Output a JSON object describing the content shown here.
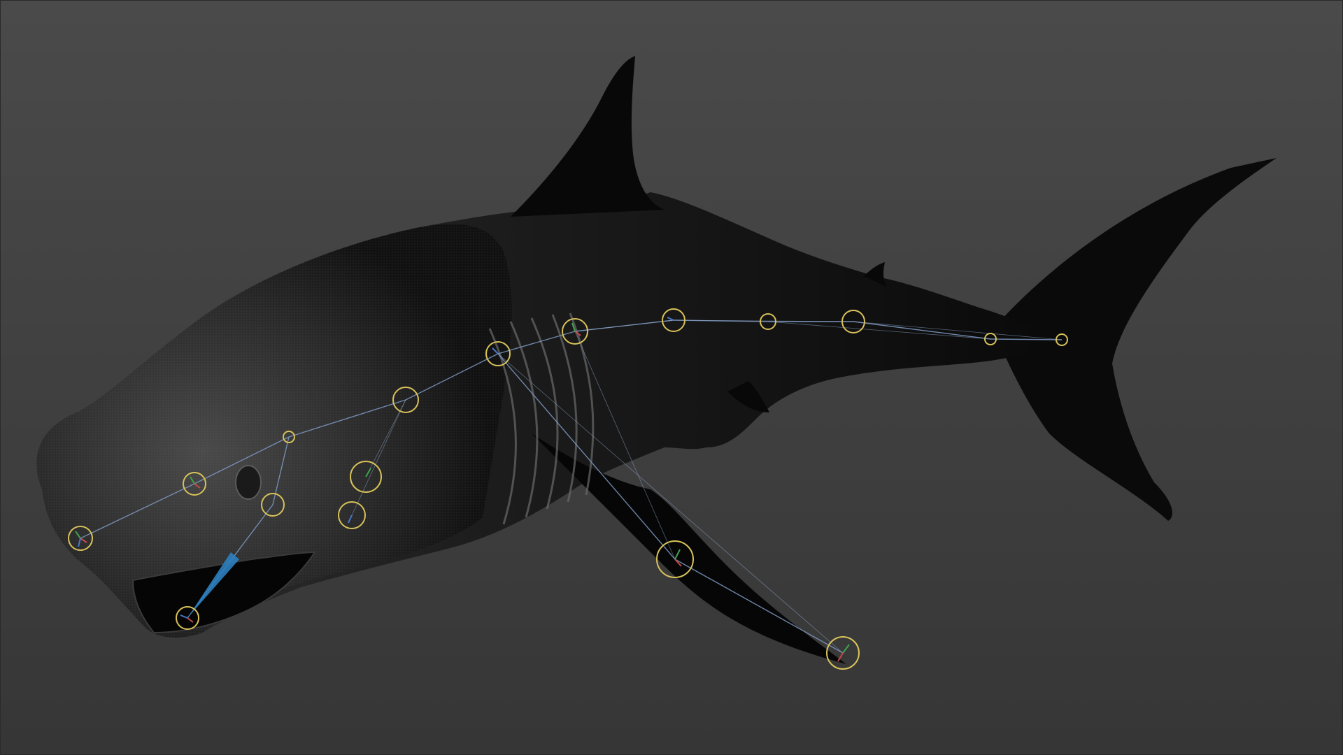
{
  "viewport": {
    "background_top": "#4a4a4a",
    "background_bottom": "#363636",
    "model_color": "#0b0b0b",
    "mesh_highlight": "#bdbdbd",
    "joint_color": "#d8c25a",
    "bone_color": "#7f9bc4",
    "selected_bone_color": "#2d7fc0"
  },
  "model": {
    "icon": "shark-mesh-icon"
  },
  "rig": {
    "joint_count": 19
  }
}
